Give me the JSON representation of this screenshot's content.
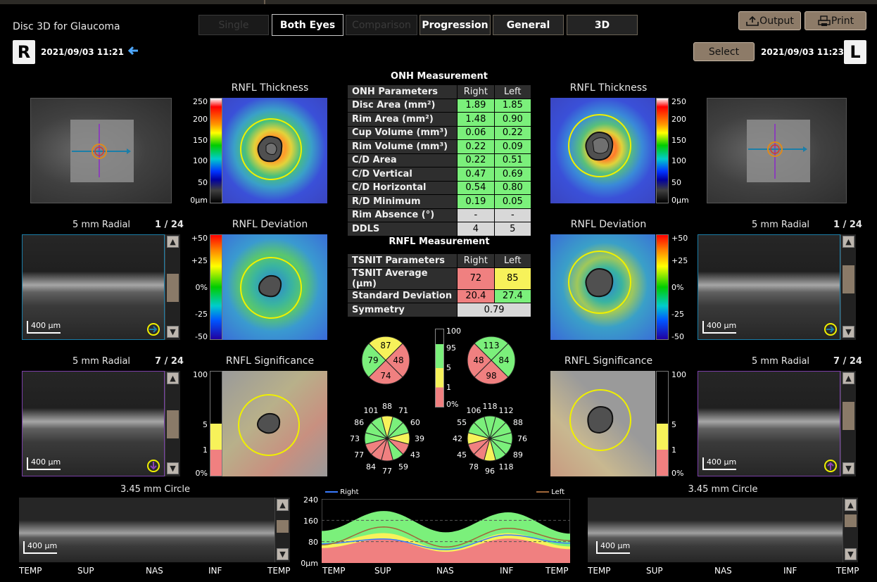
{
  "app": {
    "title": "Disc 3D for Glaucoma"
  },
  "tabs": [
    {
      "label": "Single",
      "state": "disabled"
    },
    {
      "label": "Both Eyes",
      "state": "active"
    },
    {
      "label": "Comparison",
      "state": "disabled"
    },
    {
      "label": "Progression",
      "state": "normal"
    },
    {
      "label": "General",
      "state": "normal"
    },
    {
      "label": "3D",
      "state": "normal"
    }
  ],
  "toolbar": {
    "output_label": "Output",
    "print_label": "Print",
    "select_label": "Select"
  },
  "right_eye": {
    "badge": "R",
    "datetime": "2021/09/03  11:21"
  },
  "left_eye": {
    "badge": "L",
    "datetime": "2021/09/03  11:23"
  },
  "maps": {
    "thickness_title": "RNFL Thickness",
    "deviation_title": "RNFL Deviation",
    "significance_title": "RNFL Significance",
    "thickness_ticks": [
      "250",
      "200",
      "150",
      "100",
      "50",
      "0µm"
    ],
    "deviation_ticks": [
      "+50",
      "+25",
      "0%",
      "-25",
      "-50"
    ],
    "significance_ticks": [
      "100",
      "5",
      "1",
      "0%"
    ]
  },
  "bscans": {
    "radial_label": "5 mm Radial",
    "right_top_index": "1 / 24",
    "right_mid_index": "7 / 24",
    "left_top_index": "1 / 24",
    "left_mid_index": "7 / 24",
    "scale": "400 µm",
    "circle_label": "3.45 mm Circle"
  },
  "onh": {
    "title": "ONH Measurement",
    "header": [
      "ONH Parameters",
      "Right",
      "Left"
    ],
    "rows": [
      {
        "label": "Disc Area (mm²)",
        "right": "1.89",
        "left": "1.85",
        "rc": "g",
        "lc": "g"
      },
      {
        "label": "Rim Area (mm²)",
        "right": "1.48",
        "left": "0.90",
        "rc": "g",
        "lc": "g"
      },
      {
        "label": "Cup Volume (mm³)",
        "right": "0.06",
        "left": "0.22",
        "rc": "g",
        "lc": "g"
      },
      {
        "label": "Rim Volume (mm³)",
        "right": "0.22",
        "left": "0.09",
        "rc": "g",
        "lc": "g"
      },
      {
        "label": "C/D Area",
        "right": "0.22",
        "left": "0.51",
        "rc": "g",
        "lc": "g"
      },
      {
        "label": "C/D Vertical",
        "right": "0.47",
        "left": "0.69",
        "rc": "g",
        "lc": "g"
      },
      {
        "label": "C/D Horizontal",
        "right": "0.54",
        "left": "0.80",
        "rc": "g",
        "lc": "g"
      },
      {
        "label": "R/D Minimum",
        "right": "0.19",
        "left": "0.05",
        "rc": "g",
        "lc": "g"
      },
      {
        "label": "Rim Absence (°)",
        "right": "-",
        "left": "-",
        "rc": "gr",
        "lc": "gr"
      },
      {
        "label": "DDLS",
        "right": "4",
        "left": "5",
        "rc": "gr",
        "lc": "gr"
      }
    ]
  },
  "rnfl": {
    "title": "RNFL Measurement",
    "header": [
      "TSNIT Parameters",
      "Right",
      "Left"
    ],
    "rows": [
      {
        "label": "TSNIT Average (µm)",
        "right": "72",
        "left": "85",
        "rc": "r",
        "lc": "y"
      },
      {
        "label": "Standard Deviation",
        "right": "20.4",
        "left": "27.4",
        "rc": "r",
        "lc": "g"
      }
    ],
    "symmetry_label": "Symmetry",
    "symmetry_value": "0.79"
  },
  "quadrants": {
    "right": {
      "top": "87",
      "left": "79",
      "right": "48",
      "bottom": "74"
    },
    "left": {
      "top": "113",
      "left": "48",
      "right": "84",
      "bottom": "98"
    }
  },
  "clock_hours": {
    "right": [
      "88",
      "71",
      "60",
      "39",
      "43",
      "59",
      "77",
      "84",
      "77",
      "73",
      "86",
      "101"
    ],
    "left": [
      "118",
      "112",
      "88",
      "76",
      "89",
      "118",
      "96",
      "78",
      "45",
      "42",
      "55",
      "106"
    ]
  },
  "norm_legend": [
    "100",
    "95",
    "5",
    "1",
    "0%"
  ],
  "tsnit_chart": {
    "legend_right": "Right",
    "legend_left": "Left",
    "x_labels": [
      "TEMP",
      "SUP",
      "NAS",
      "INF",
      "TEMP"
    ],
    "y_ticks": [
      "240",
      "160",
      "80",
      "0µm"
    ]
  },
  "colors": {
    "accent": "#8d7b68",
    "green": "#7bf07b",
    "yellow": "#f7f25a",
    "red": "#f08080"
  },
  "chart_data": {
    "type": "area",
    "x": [
      "TEMP",
      "SUP",
      "NAS",
      "INF",
      "TEMP"
    ],
    "ylim": [
      0,
      240
    ],
    "y_ticks": [
      0,
      80,
      160,
      240
    ],
    "grid": true,
    "legend": "top",
    "normative_bands": {
      "p99_upper": [
        120,
        195,
        115,
        190,
        110
      ],
      "p5": [
        72,
        112,
        50,
        112,
        62
      ],
      "p1": [
        56,
        90,
        42,
        92,
        52
      ]
    },
    "series": [
      {
        "name": "Right",
        "color": "#3a7bff",
        "values": [
          72,
          90,
          50,
          105,
          74
        ]
      },
      {
        "name": "Left",
        "color": "#a0673a",
        "values": [
          68,
          135,
          60,
          130,
          84
        ]
      }
    ]
  }
}
